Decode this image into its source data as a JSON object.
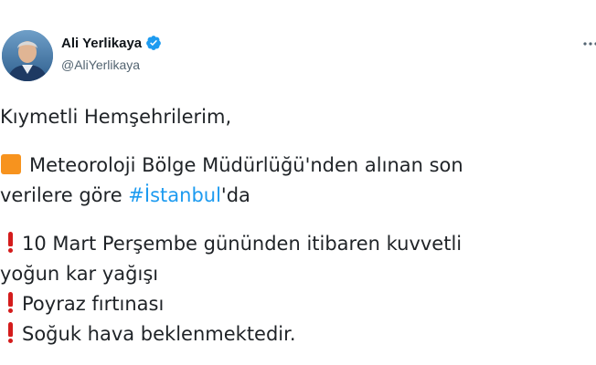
{
  "author": {
    "display_name": "Ali Yerlikaya",
    "handle": "@AliYerlikaya",
    "verified": true
  },
  "icons": {
    "avatar": "profile-photo",
    "verified": "verified-badge-icon",
    "more": "more-options-icon",
    "orange_square": "large-orange-square-emoji",
    "exclamation": "red-exclamation-mark-emoji"
  },
  "colors": {
    "hashtag": "#1d9bf0",
    "verified_badge": "#1d9bf0",
    "orange_square": "#f7931e",
    "exclamation": "#d41c1c"
  },
  "tweet": {
    "greeting": "Kıymetli Hemşehrilerim,",
    "line2a": "Meteoroloji Bölge Müdürlüğü'nden alınan son",
    "line2b_prefix": "verilere göre ",
    "hashtag": "#İstanbul",
    "line2b_suffix": "'da",
    "item1a": "10 Mart Perşembe gününden itibaren kuvvetli",
    "item1b": "yoğun kar yağışı",
    "item2": "Poyraz fırtınası",
    "item3": "Soğuk hava beklenmektedir."
  }
}
